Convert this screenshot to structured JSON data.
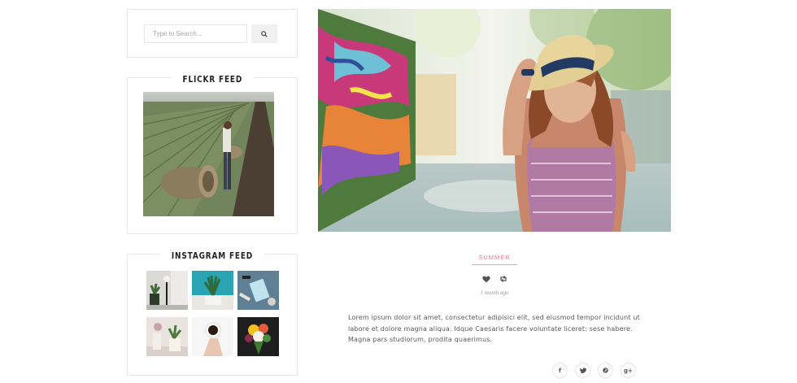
{
  "search": {
    "placeholder": "Type to Search..."
  },
  "flickr": {
    "title": "FLICKR FEED"
  },
  "instagram": {
    "title": "INSTAGRAM FEED"
  },
  "post": {
    "category": "SUMMER",
    "date": "1 month ago",
    "excerpt": "Lorem ipsum dolor sit amet, consectetur adipisici elit, sed eiusmod tempor incidunt ut labore et dolore magna aliqua. Idque Caesaris facere voluntate liceret: sese habere. Magna pars studiorum, prodita quaerimus."
  },
  "share": {
    "facebook": "f",
    "google_plus": "g+"
  },
  "colors": {
    "accent": "#e07b8a",
    "border": "#e8e8e8",
    "text": "#555555"
  },
  "icons": [
    "search-icon",
    "heart-icon",
    "retweet-icon",
    "facebook-icon",
    "twitter-icon",
    "pinterest-icon",
    "google-plus-icon"
  ]
}
